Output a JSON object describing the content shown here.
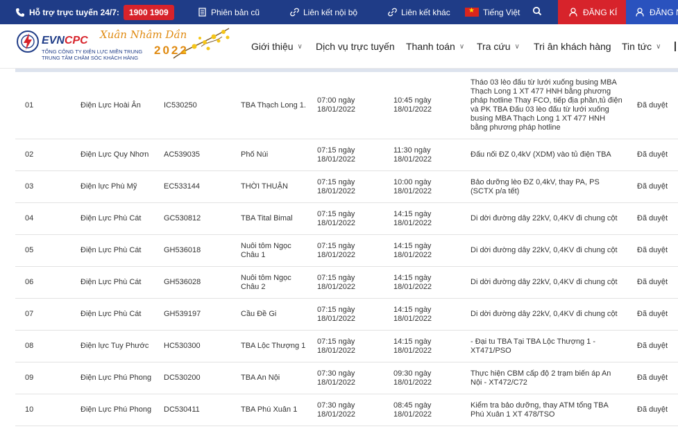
{
  "topbar": {
    "support_label": "Hỗ trợ trực tuyến 24/7:",
    "hotline": "1900 1909",
    "old_version": "Phiên bản cũ",
    "internal_links": "Liên kết nội bộ",
    "other_links": "Liên kết khác",
    "language": "Tiếng Việt",
    "register": "ĐĂNG KÍ",
    "login": "ĐĂNG N"
  },
  "logo": {
    "brand_evn": "EVN",
    "brand_cpc": "CPC",
    "sub1": "TỔNG CÔNG TY ĐIỆN LỰC MIỀN TRUNG",
    "sub2": "TRUNG TÂM CHĂM SÓC KHÁCH HÀNG",
    "tet_script": "Xuân Nhâm Dần",
    "tet_year": "2022"
  },
  "nav": [
    {
      "label": "Giới thiệu",
      "dropdown": true
    },
    {
      "label": "Dịch vụ trực tuyến",
      "dropdown": false
    },
    {
      "label": "Thanh toán",
      "dropdown": true
    },
    {
      "label": "Tra cứu",
      "dropdown": true
    },
    {
      "label": "Tri ân khách hàng",
      "dropdown": false
    },
    {
      "label": "Tin tức",
      "dropdown": true
    }
  ],
  "rows": [
    {
      "stt": "01",
      "unit": "Điện Lực Hoài Ân",
      "code": "IC530250",
      "tba": "TBA Thạch Long 1.",
      "from": "07:00 ngày 18/01/2022",
      "to": "10:45 ngày 18/01/2022",
      "content": "Tháo 03 lèo đấu từ lưới xuống busing MBA Thạch Long 1 XT 477 HNH bằng phương pháp hotline Thay FCO, tiếp địa phần,tủ điện và PK TBA Đấu 03 lèo đấu từ lưới xuống busing MBA Thạch Long 1 XT 477 HNH bằng phương pháp hotline",
      "status": "Đã duyệt"
    },
    {
      "stt": "02",
      "unit": "Điện Lực Quy Nhơn",
      "code": "AC539035",
      "tba": "Phố Núi",
      "from": "07:15 ngày 18/01/2022",
      "to": "11:30 ngày 18/01/2022",
      "content": "Đấu nối ĐZ 0,4kV (XDM) vào tủ điện TBA",
      "status": "Đã duyệt"
    },
    {
      "stt": "03",
      "unit": "Điện lực Phù Mỹ",
      "code": "EC533144",
      "tba": "THỜI THUẬN",
      "from": "07:15 ngày 18/01/2022",
      "to": "10:00 ngày 18/01/2022",
      "content": "Bảo dưỡng lèo ĐZ 0,4kV, thay PA, PS (SCTX p/a tết)",
      "status": "Đã duyệt"
    },
    {
      "stt": "04",
      "unit": "Điện Lực Phù Cát",
      "code": "GC530812",
      "tba": "TBA Tital Bimal",
      "from": "07:15 ngày 18/01/2022",
      "to": "14:15 ngày 18/01/2022",
      "content": "Di dời đường dây 22kV, 0,4KV đi chung cột",
      "status": "Đã duyệt"
    },
    {
      "stt": "05",
      "unit": "Điện Lực Phù Cát",
      "code": "GH536018",
      "tba": "Nuôi tôm Ngọc Châu 1",
      "from": "07:15 ngày 18/01/2022",
      "to": "14:15 ngày 18/01/2022",
      "content": "Di dời đường dây 22kV, 0,4KV đi chung cột",
      "status": "Đã duyệt"
    },
    {
      "stt": "06",
      "unit": "Điện Lực Phù Cát",
      "code": "GH536028",
      "tba": "Nuôi tôm Ngọc Châu 2",
      "from": "07:15 ngày 18/01/2022",
      "to": "14:15 ngày 18/01/2022",
      "content": "Di dời đường dây 22kV, 0,4KV đi chung cột",
      "status": "Đã duyệt"
    },
    {
      "stt": "07",
      "unit": "Điện Lực Phù Cát",
      "code": "GH539197",
      "tba": "Cầu Đề Gi",
      "from": "07:15 ngày 18/01/2022",
      "to": "14:15 ngày 18/01/2022",
      "content": "Di dời đường dây 22kV, 0,4KV đi chung cột",
      "status": "Đã duyệt"
    },
    {
      "stt": "08",
      "unit": "Điện lực Tuy Phước",
      "code": "HC530300",
      "tba": "TBA Lộc Thượng 1",
      "from": "07:15 ngày 18/01/2022",
      "to": "14:15 ngày 18/01/2022",
      "content": "- Đại tu TBA Tại TBA Lộc Thượng 1 - XT471/PSO",
      "status": "Đã duyệt"
    },
    {
      "stt": "09",
      "unit": "Điện Lực Phú Phong",
      "code": "DC530200",
      "tba": "TBA An Nội",
      "from": "07:30 ngày 18/01/2022",
      "to": "09:30 ngày 18/01/2022",
      "content": "Thực hiện CBM cấp độ 2 trạm biến áp An Nội - XT472/C72",
      "status": "Đã duyệt"
    },
    {
      "stt": "10",
      "unit": "Điện Lực Phú Phong",
      "code": "DC530411",
      "tba": "TBA Phú Xuân 1",
      "from": "07:30 ngày 18/01/2022",
      "to": "08:45 ngày 18/01/2022",
      "content": "Kiểm tra bảo dưỡng, thay ATM tổng TBA Phú Xuân 1 XT 478/TSO",
      "status": "Đã duyệt"
    }
  ],
  "colors": {
    "topbar": "#1f3c87",
    "accent_red": "#d7232b",
    "login_blue": "#2a52be",
    "tet_gold": "#e08a10"
  }
}
